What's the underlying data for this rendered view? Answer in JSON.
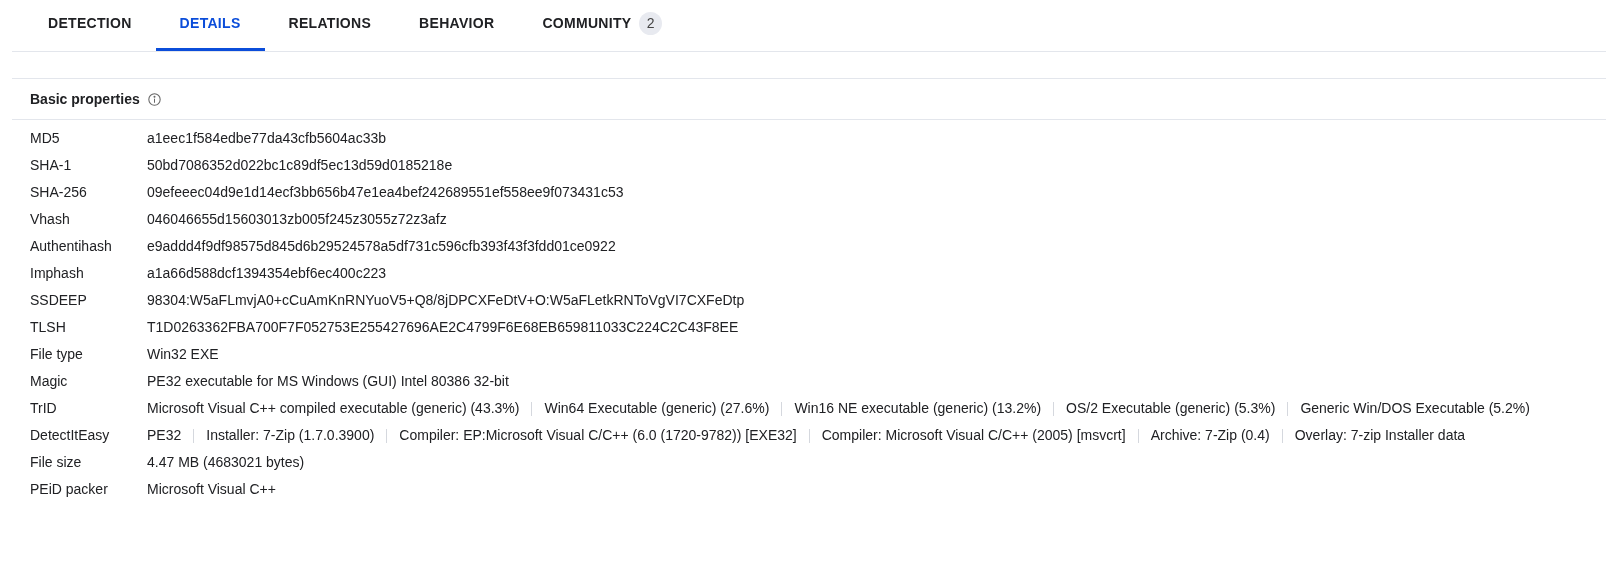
{
  "tabs": [
    {
      "label": "DETECTION",
      "selected": false
    },
    {
      "label": "DETAILS",
      "selected": true
    },
    {
      "label": "RELATIONS",
      "selected": false
    },
    {
      "label": "BEHAVIOR",
      "selected": false
    },
    {
      "label": "COMMUNITY",
      "selected": false,
      "count": "2"
    }
  ],
  "section": {
    "title": "Basic properties",
    "rows": [
      {
        "label": "MD5",
        "values": [
          "a1eec1f584edbe77da43cfb5604ac33b"
        ]
      },
      {
        "label": "SHA-1",
        "values": [
          "50bd7086352d022bc1c89df5ec13d59d0185218e"
        ]
      },
      {
        "label": "SHA-256",
        "values": [
          "09efeeec04d9e1d14ecf3bb656b47e1ea4bef242689551ef558ee9f073431c53"
        ]
      },
      {
        "label": "Vhash",
        "values": [
          "046046655d15603013zb005f245z3055z72z3afz"
        ]
      },
      {
        "label": "Authentihash",
        "values": [
          "e9addd4f9df98575d845d6b29524578a5df731c596cfb393f43f3fdd01ce0922"
        ]
      },
      {
        "label": "Imphash",
        "values": [
          "a1a66d588dcf1394354ebf6ec400c223"
        ]
      },
      {
        "label": "SSDEEP",
        "values": [
          "98304:W5aFLmvjA0+cCuAmKnRNYuoV5+Q8/8jDPCXFeDtV+O:W5aFLetkRNToVgVI7CXFeDtp"
        ]
      },
      {
        "label": "TLSH",
        "values": [
          "T1D0263362FBA700F7F052753E255427696AE2C4799F6E68EB659811033C224C2C43F8EE"
        ]
      },
      {
        "label": "File type",
        "values": [
          "Win32 EXE"
        ]
      },
      {
        "label": "Magic",
        "values": [
          "PE32 executable for MS Windows (GUI) Intel 80386 32-bit"
        ]
      },
      {
        "label": "TrID",
        "values": [
          "Microsoft Visual C++ compiled executable (generic) (43.3%)",
          "Win64 Executable (generic) (27.6%)",
          "Win16 NE executable (generic) (13.2%)",
          "OS/2 Executable (generic) (5.3%)",
          "Generic Win/DOS Executable (5.2%)"
        ]
      },
      {
        "label": "DetectItEasy",
        "values": [
          "PE32",
          "Installer: 7-Zip (1.7.0.3900)",
          "Compiler: EP:Microsoft Visual C/C++ (6.0 (1720-9782)) [EXE32]",
          "Compiler: Microsoft Visual C/C++ (2005) [msvcrt]",
          "Archive: 7-Zip (0.4)",
          "Overlay: 7-zip Installer data"
        ]
      },
      {
        "label": "File size",
        "values": [
          "4.47 MB (4683021 bytes)"
        ]
      },
      {
        "label": "PEiD packer",
        "values": [
          "Microsoft Visual C++"
        ]
      }
    ]
  }
}
